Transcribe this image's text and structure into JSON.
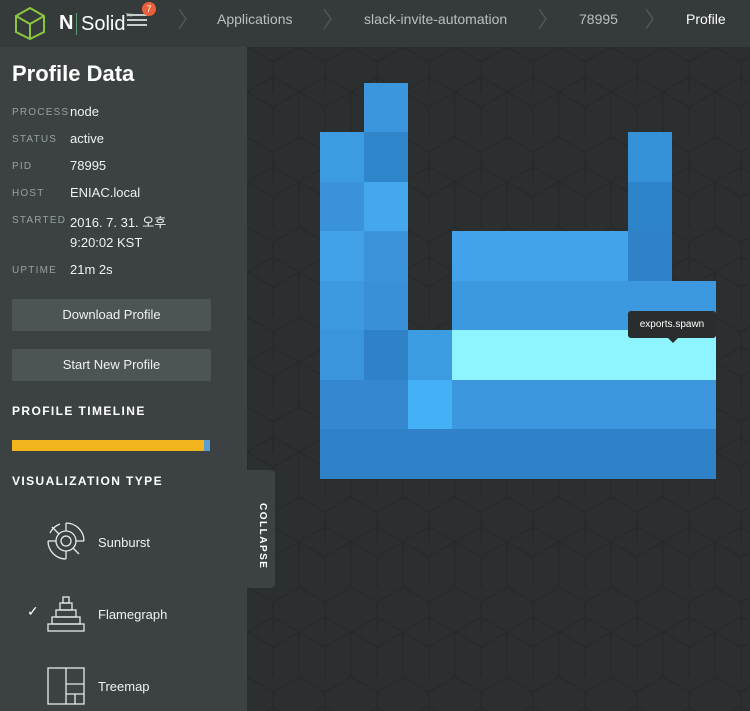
{
  "header": {
    "logo_n": "N",
    "logo_solid": "Solid",
    "logo_tm": "™",
    "notification_count": "7",
    "breadcrumbs": [
      "Applications",
      "slack-invite-automation",
      "78995",
      "Profile"
    ]
  },
  "sidebar": {
    "title": "Profile Data",
    "meta": [
      {
        "label": "PROCESS",
        "value": "node"
      },
      {
        "label": "STATUS",
        "value": "active"
      },
      {
        "label": "PID",
        "value": "78995"
      },
      {
        "label": "HOST",
        "value": "ENIAC.local"
      },
      {
        "label": "STARTED",
        "value": "2016. 7. 31. 오후",
        "value2": "9:20:02 KST"
      },
      {
        "label": "UPTIME",
        "value": "21m 2s"
      }
    ],
    "download_label": "Download Profile",
    "start_new_label": "Start New Profile",
    "timeline_heading": "PROFILE TIMELINE",
    "viz_heading": "VISUALIZATION TYPE",
    "viz_types": [
      {
        "label": "Sunburst",
        "icon": "sunburst-icon",
        "selected": false
      },
      {
        "label": "Flamegraph",
        "icon": "flamegraph-icon",
        "selected": true
      },
      {
        "label": "Treemap",
        "icon": "treemap-icon",
        "selected": false
      }
    ],
    "check_mark": "✓",
    "collapse_label": "COLLAPSE"
  },
  "flamegraph": {
    "tooltip": "exports.spawn",
    "colors": {
      "base": "#3b8fd4",
      "light": "#43a3ea",
      "mid": "#3a95dc",
      "dark": "#2f82c8",
      "highlight": "#8ef4ff",
      "bright": "#44b0f5"
    }
  }
}
